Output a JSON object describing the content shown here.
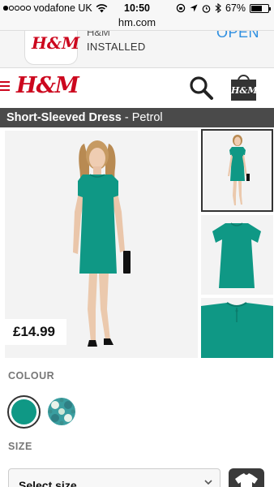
{
  "status_bar": {
    "carrier": "vodafone UK",
    "time": "10:50",
    "battery": "67%",
    "battery_level": 0.67
  },
  "url_bar": {
    "url": "hm.com"
  },
  "app_banner": {
    "app_name": "H&M",
    "status": "INSTALLED",
    "open_label": "OPEN",
    "logo_text": "H&M"
  },
  "header": {
    "logo_text": "H&M"
  },
  "product": {
    "name": "Short-Sleeved Dress",
    "separator": " - ",
    "colour_name": "Petrol",
    "price": "£14.99"
  },
  "options": {
    "colour_label": "COLOUR",
    "size_label": "SIZE",
    "size_placeholder": "Select size",
    "swatches": [
      {
        "name": "petrol",
        "color": "#0f9885",
        "selected": true
      },
      {
        "name": "patterned",
        "color": "#3a9ea0",
        "selected": false
      }
    ]
  },
  "colors": {
    "brand_red": "#cc071e",
    "dress": "#0f9885",
    "title_bar": "#4a4a4a",
    "open_blue": "#2f8fe0"
  }
}
